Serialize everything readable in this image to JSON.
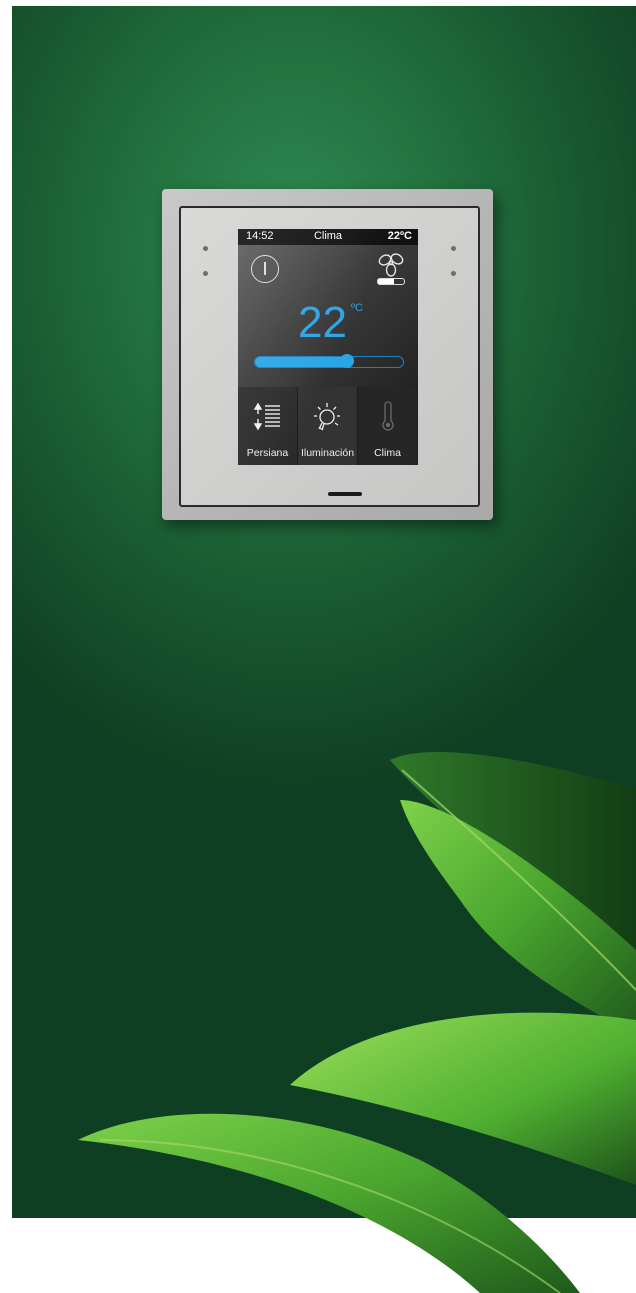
{
  "scene": {
    "wall_color": "#23723f",
    "leaf_color": "#4aa52e"
  },
  "thermostat": {
    "status_bar": {
      "time": "14:52",
      "title": "Clima",
      "outdoor_temp": "22ºC"
    },
    "setpoint": {
      "value": "22",
      "unit": "ºC"
    },
    "slider_level": 0.62,
    "fan_speed_level": 0.6,
    "accent_color": "#2aa6e6",
    "icons": [
      "power-icon",
      "fan-icon",
      "blind-icon",
      "bulb-icon",
      "thermometer-icon"
    ],
    "tiles": [
      {
        "label": "Persiana",
        "icon": "blind-icon"
      },
      {
        "label": "Iluminación",
        "icon": "bulb-icon"
      },
      {
        "label": "Clima",
        "icon": "thermometer-icon"
      }
    ]
  }
}
